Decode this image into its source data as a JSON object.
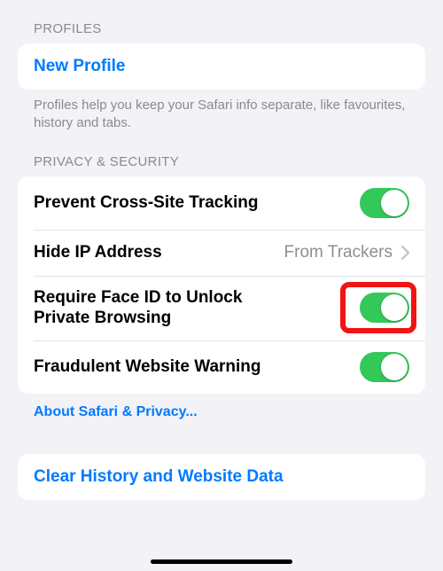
{
  "profiles": {
    "header": "Profiles",
    "new_profile": "New Profile",
    "footer": "Profiles help you keep your Safari info separate, like favourites, history and tabs."
  },
  "privacy": {
    "header": "Privacy & Security",
    "prevent_tracking": {
      "label": "Prevent Cross-Site Tracking",
      "on": true
    },
    "hide_ip": {
      "label": "Hide IP Address",
      "detail": "From Trackers"
    },
    "faceid": {
      "label": "Require Face ID to Unlock Private Browsing",
      "on": true
    },
    "fraud": {
      "label": "Fraudulent Website Warning",
      "on": true
    },
    "about_link": "About Safari & Privacy..."
  },
  "clear": {
    "label": "Clear History and Website Data"
  }
}
